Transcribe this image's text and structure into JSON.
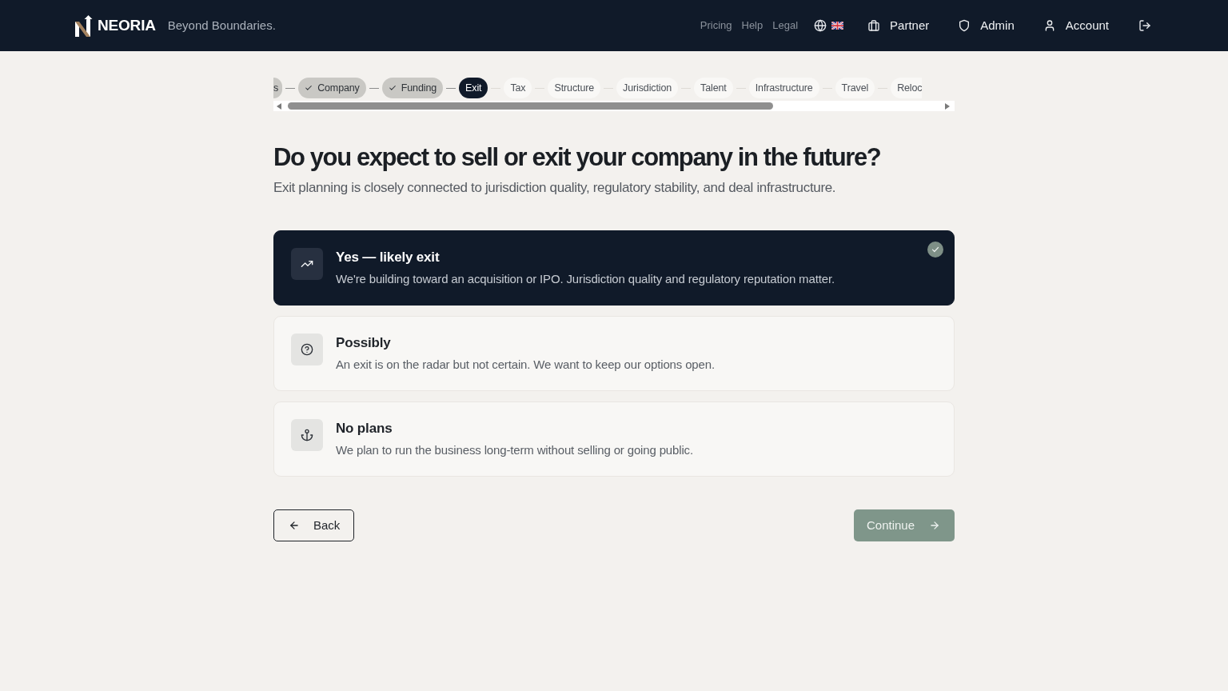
{
  "header": {
    "brand": "NEORIA",
    "tagline": "Beyond Boundaries.",
    "links": [
      "Pricing",
      "Help",
      "Legal"
    ],
    "nav": [
      "Partner",
      "Admin",
      "Account"
    ]
  },
  "steps": [
    {
      "label": "s",
      "completed": true,
      "selected": false
    },
    {
      "label": "Company",
      "completed": true,
      "selected": false
    },
    {
      "label": "Funding",
      "completed": true,
      "selected": false
    },
    {
      "label": "Exit",
      "completed": false,
      "selected": true
    },
    {
      "label": "Tax",
      "completed": false,
      "selected": false
    },
    {
      "label": "Structure",
      "completed": false,
      "selected": false
    },
    {
      "label": "Jurisdiction",
      "completed": false,
      "selected": false
    },
    {
      "label": "Talent",
      "completed": false,
      "selected": false
    },
    {
      "label": "Infrastructure",
      "completed": false,
      "selected": false
    },
    {
      "label": "Travel",
      "completed": false,
      "selected": false
    },
    {
      "label": "Reloc",
      "completed": false,
      "selected": false
    }
  ],
  "question": {
    "title": "Do you expect to sell or exit your company in the future?",
    "subtitle": "Exit planning is closely connected to jurisdiction quality, regulatory stability, and deal infrastructure."
  },
  "options": [
    {
      "title": "Yes — likely exit",
      "description": "We're building toward an acquisition or IPO. Jurisdiction quality and regulatory reputation matter.",
      "selected": true
    },
    {
      "title": "Possibly",
      "description": "An exit is on the radar but not certain. We want to keep our options open.",
      "selected": false
    },
    {
      "title": "No plans",
      "description": "We plan to run the business long-term without selling or going public.",
      "selected": false
    }
  ],
  "actions": {
    "back": "Back",
    "continue": "Continue"
  }
}
